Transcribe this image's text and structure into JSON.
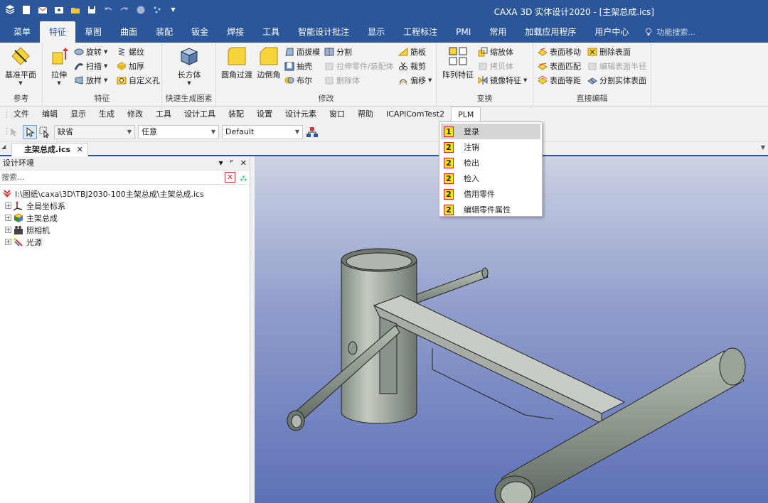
{
  "title": "CAXA 3D 实体设计2020 - [主架总成.ics]",
  "quick_access": [
    "shield-icon",
    "new-icon",
    "mail-icon",
    "email-icon",
    "open-icon",
    "save-icon",
    "undo-icon",
    "redo-icon",
    "globe-icon",
    "sparkle-icon",
    "dropdown-icon"
  ],
  "menu_tabs": [
    "菜单",
    "特征",
    "草图",
    "曲面",
    "装配",
    "钣金",
    "焊接",
    "工具",
    "智能设计批注",
    "显示",
    "工程标注",
    "PMI",
    "常用",
    "加载应用程序",
    "用户中心"
  ],
  "active_tab": "特征",
  "feature_search_placeholder": "功能搜索...",
  "ribbon": {
    "ref": {
      "label": "参考",
      "datum": "基准平面"
    },
    "feature": {
      "label": "特征",
      "extrude": "拉伸",
      "revolve": "旋转",
      "sweep": "扫描",
      "loft": "放样",
      "thread": "螺纹",
      "thicken": "加厚",
      "custom_hole": "自定义孔"
    },
    "quick": {
      "label": "快速生成图素",
      "box": "长方体"
    },
    "modify": {
      "label": "修改",
      "fillet": "圆角过渡",
      "chamfer": "边倒角",
      "draft": "面拔模",
      "shell": "抽壳",
      "boolean": "布尔",
      "split": "分割",
      "pull_part": "拉伸零件/装配体",
      "delete_body": "删除体",
      "rib": "筋板",
      "trim": "裁剪",
      "offset": "偏移"
    },
    "transform": {
      "label": "变换",
      "pattern": "阵列特征",
      "scale": "缩放体",
      "copy_body": "拷贝体",
      "mirror": "镜像特征"
    },
    "direct": {
      "label": "直接编辑",
      "move_face": "表面移动",
      "match_face": "表面匹配",
      "offset_face": "表面等距",
      "delete_face": "删除表面",
      "edit_radius": "编辑表面半径",
      "split_face": "分割实体表面"
    }
  },
  "menubar": [
    "文件",
    "编辑",
    "显示",
    "生成",
    "修改",
    "工具",
    "设计工具",
    "装配",
    "设置",
    "设计元素",
    "窗口",
    "帮助",
    "ICAPIComTest2",
    "PLM"
  ],
  "toolbar2": {
    "combo1": "缺省",
    "combo2": "任意",
    "combo3": "Default"
  },
  "doc_tab": "主架总成.ics",
  "panel": {
    "title": "设计环境",
    "search_placeholder": "搜索...",
    "root": "I:\\图纸\\caxa\\3D\\TBJ2030-100主架总成\\主架总成.ics",
    "nodes": [
      "全局坐标系",
      "主架总成",
      "照相机",
      "光源"
    ]
  },
  "plm_menu": {
    "items": [
      {
        "num": "1",
        "label": "登录"
      },
      {
        "num": "2",
        "label": "注销"
      },
      {
        "num": "2",
        "label": "检出"
      },
      {
        "num": "2",
        "label": "检入"
      },
      {
        "num": "2",
        "label": "借用零件"
      },
      {
        "num": "2",
        "label": "编辑零件属性"
      }
    ]
  },
  "colors": {
    "accent": "#2b579a",
    "viewport_top": "#cdd2e3",
    "viewport_bottom": "#5d71b7"
  }
}
